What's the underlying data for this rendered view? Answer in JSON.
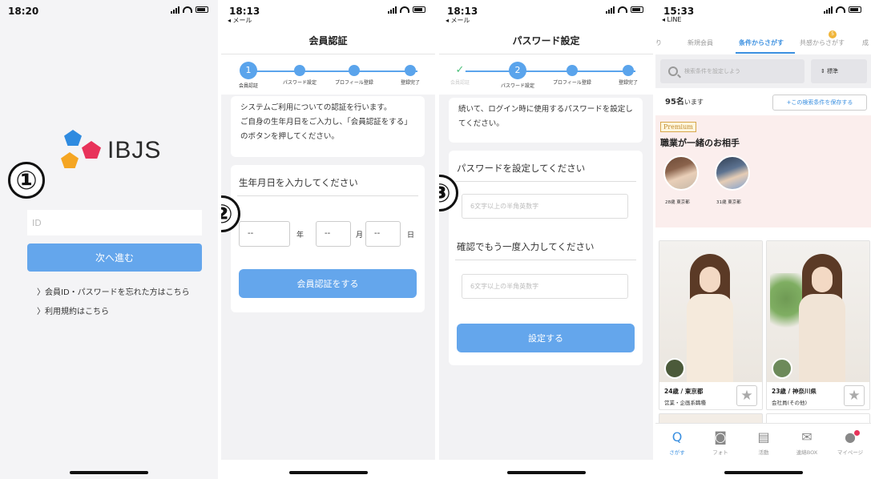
{
  "screen1": {
    "time": "18:20",
    "step_number": "①",
    "logo_text": "IBJS",
    "id_placeholder": "ID",
    "next_button": "次へ進む",
    "links": [
      "会員ID・パスワードを忘れた方はこちら",
      "利用規約はこちら"
    ]
  },
  "screen2": {
    "time": "18:13",
    "back_app": "◂ メール",
    "step_number": "②",
    "title": "会員認証",
    "steps": [
      {
        "label": "会員認証",
        "num": "1"
      },
      {
        "label": "パスワード設定"
      },
      {
        "label": "プロフィール登録"
      },
      {
        "label": "登録完了"
      }
    ],
    "intro": [
      "システムご利用についての認証を行います。",
      "ご自身の生年月日をご入力し、「会員認証をする」",
      "のボタンを押してください。"
    ],
    "birth_label": "生年月日を入力してください",
    "date_placeholder": "--",
    "units": [
      "年",
      "月",
      "日"
    ],
    "submit": "会員認証をする"
  },
  "screen3": {
    "time": "18:13",
    "back_app": "◂ メール",
    "step_number": "③",
    "title": "パスワード設定",
    "steps": [
      {
        "label": "会員認証",
        "done_mark": "✓"
      },
      {
        "label": "パスワード設定",
        "num": "2"
      },
      {
        "label": "プロフィール登録"
      },
      {
        "label": "登録完了"
      }
    ],
    "intro": [
      "続いて、ログイン時に使用するパスワードを設定し",
      "てください。"
    ],
    "pw_label": "パスワードを設定してください",
    "pw_placeholder": "6文字以上の半角英数字",
    "confirm_label": "確認でもう一度入力してください",
    "confirm_placeholder": "6文字以上の半角英数字",
    "submit": "設定する"
  },
  "screen4": {
    "time": "15:33",
    "back_app": "◂ LINE",
    "tabs": [
      "り",
      "新規会員",
      "条件からさがす",
      "共感からさがす",
      "成"
    ],
    "active_tab": "条件からさがす",
    "tab_badge": "5",
    "search_placeholder": "検索条件を設定しよう",
    "sort_label": "⇕ 標準",
    "count": "95名",
    "count_suffix": "います",
    "save_search": "+この検索条件を保存する",
    "premium_tag": "Premium",
    "premium_title": "職業が一緒のお相手",
    "premium_people": [
      "28歳 東京都",
      "31歳 東京都"
    ],
    "cards": [
      {
        "age_loc": "24歳 / 東京都",
        "job": "営業・企画系職種",
        "star": "★"
      },
      {
        "age_loc": "23歳 / 神奈川県",
        "job": "会社員(その他)",
        "star": "★"
      }
    ],
    "tabbar": [
      {
        "icon": "Q",
        "label": "さがす"
      },
      {
        "icon": "◙",
        "label": "フォト"
      },
      {
        "icon": "▤",
        "label": "活動"
      },
      {
        "icon": "✉",
        "label": "連絡BOX"
      },
      {
        "icon": "●",
        "label": "マイページ"
      }
    ],
    "accent_color": "#3a8fe0"
  }
}
